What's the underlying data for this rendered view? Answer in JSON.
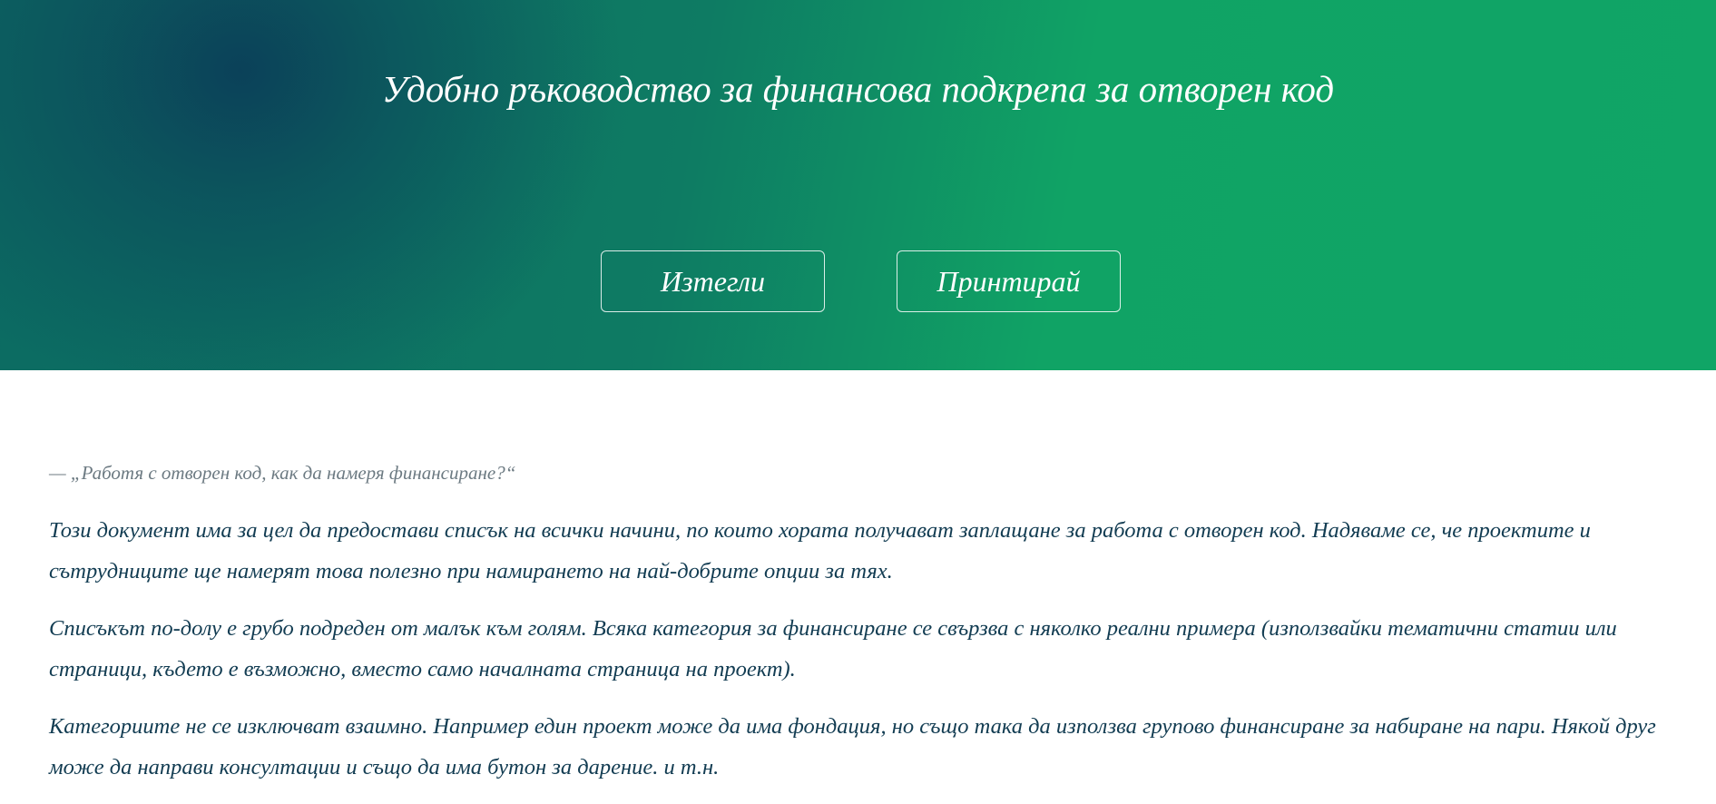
{
  "header": {
    "title": "Удобно ръководство за финансова подкрепа за отворен код",
    "buttons": {
      "download": "Изтегли",
      "print": "Принтирай"
    }
  },
  "content": {
    "quote": "— „Работя с отворен код, как да намеря финансиране?“",
    "paragraphs": [
      "Този документ има за цел да предостави списък на всички начини, по които хората получават заплащане за работа с отворен код. Надяваме се, че проектите и сътрудниците ще намерят това полезно при намирането на най-добрите опции за тях.",
      "Списъкът по-долу е грубо подреден от малък към голям. Всяка категория за финансиране се свързва с няколко реални примера (използвайки тематични статии или страници, където е възможно, вместо само началната страница на проект).",
      "Категориите не се изключват взаимно. Например един проект може да има фондация, но също така да използва групово финансиране за набиране на пари. Някой друг може да направи консултации и също да има бутон за дарение. и т.н."
    ]
  },
  "colors": {
    "accent_green": "#10a365",
    "dark_teal": "#0b4159",
    "text": "#123c52",
    "quote": "#6c7a82"
  }
}
